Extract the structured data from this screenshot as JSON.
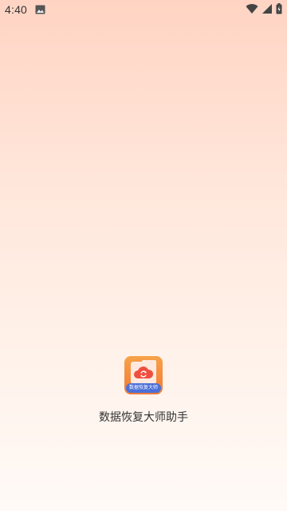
{
  "status_bar": {
    "time": "4:40",
    "icons": [
      "image-notification-icon",
      "wifi-icon",
      "cellular-signal-icon",
      "battery-icon"
    ]
  },
  "splash": {
    "app_name": "数据恢复大师助手",
    "icon_badge_text": "数据恢复大师"
  },
  "colors": {
    "background_top": "#ffd4c3",
    "background_bottom": "#fffaf7",
    "icon_orange": "#f07a35",
    "icon_banner_blue": "#4b6fd8"
  }
}
